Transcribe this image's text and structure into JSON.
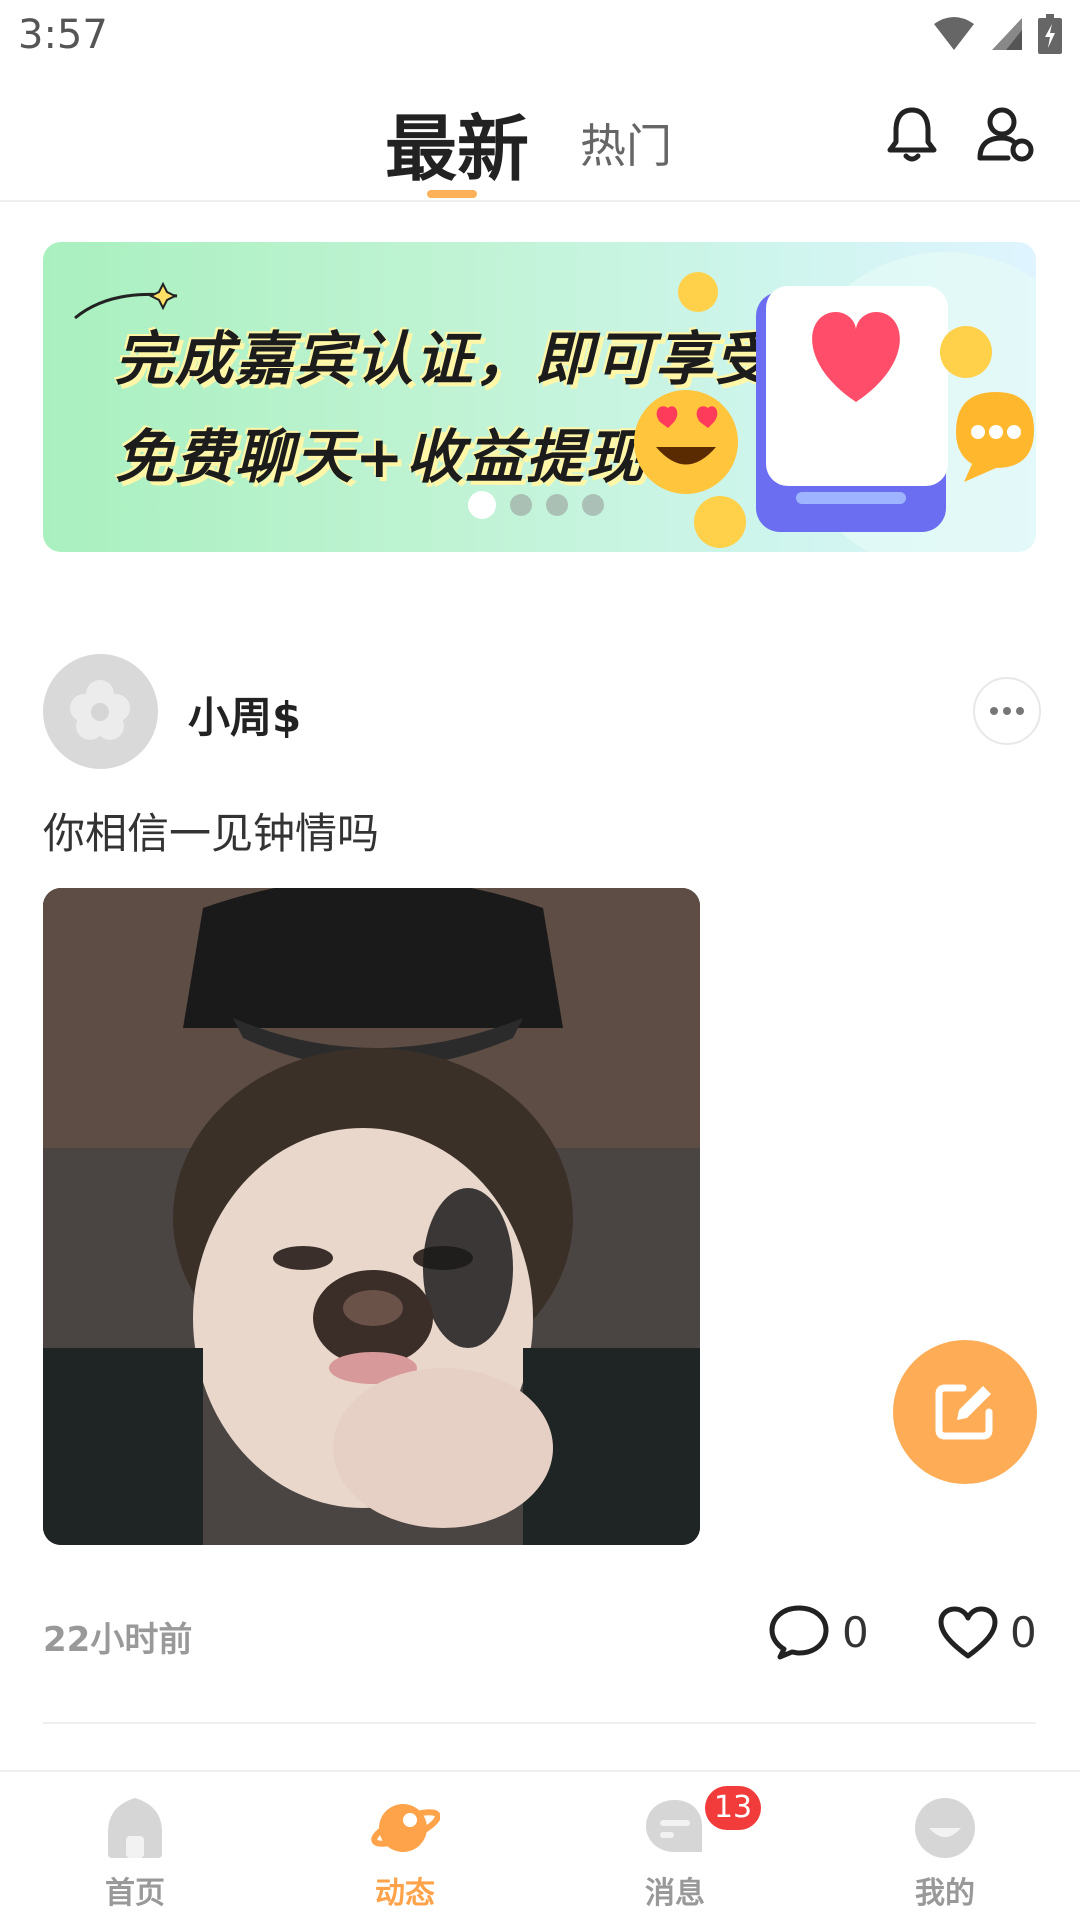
{
  "status_bar": {
    "time": "3:57"
  },
  "header": {
    "tabs": [
      {
        "label": "最新",
        "active": true
      },
      {
        "label": "热门",
        "active": false
      }
    ]
  },
  "banner": {
    "line1": "完成嘉宾认证，即可享受",
    "line2": "免费聊天+收益提现！",
    "page_count": 4,
    "active_page": 1
  },
  "post": {
    "username": "小周$",
    "text": "你相信一见钟情吗",
    "time": "22小时前",
    "comments": "0",
    "likes": "0"
  },
  "bottom_nav": {
    "items": [
      {
        "label": "首页",
        "icon": "home-icon"
      },
      {
        "label": "动态",
        "icon": "planet-icon",
        "active": true
      },
      {
        "label": "消息",
        "icon": "message-icon",
        "badge": "13"
      },
      {
        "label": "我的",
        "icon": "profile-icon"
      }
    ]
  },
  "colors": {
    "accent": "#ffac57",
    "badge": "#f23c3c"
  }
}
